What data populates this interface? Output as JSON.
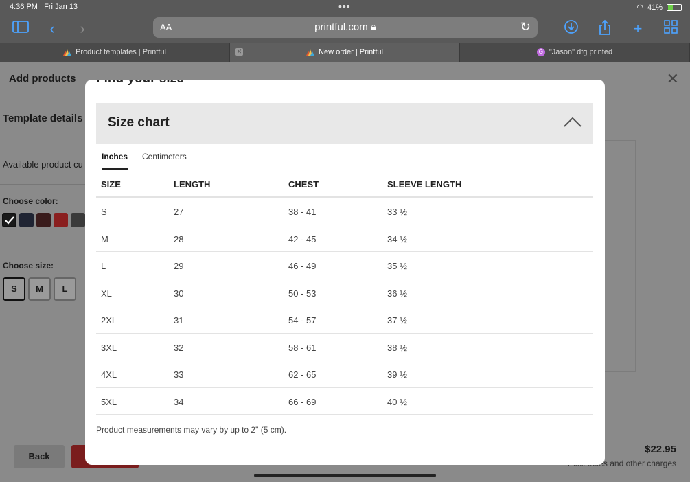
{
  "status": {
    "time": "4:36 PM",
    "date": "Fri Jan 13",
    "battery": "41%",
    "battery_level": 0.41
  },
  "browser": {
    "aa_label": "AA",
    "url": "printful.com",
    "tabs": [
      {
        "label": "Product templates | Printful"
      },
      {
        "label": "New order | Printful"
      },
      {
        "label": "\"Jason\" dtg printed"
      }
    ]
  },
  "page": {
    "title": "Add products",
    "template_details": "Template details",
    "available": "Available product cu",
    "choose_color": "Choose color:",
    "colors": [
      "#1a1a1a",
      "#1f2433",
      "#3a1c1c",
      "#8a1f1f",
      "#3a3a3a"
    ],
    "choose_size": "Choose size:",
    "sizes": [
      "S",
      "M",
      "L"
    ],
    "back": "Back",
    "price": "$22.95",
    "taxes": "Excl. taxes and other charges"
  },
  "modal": {
    "title": "Find your size",
    "section": "Size chart",
    "unit_tabs": [
      "Inches",
      "Centimeters"
    ],
    "active_unit": "Inches",
    "columns": [
      "SIZE",
      "LENGTH",
      "CHEST",
      "SLEEVE LENGTH"
    ],
    "rows": [
      [
        "S",
        "27",
        "38 - 41",
        "33 ½"
      ],
      [
        "M",
        "28",
        "42 - 45",
        "34 ½"
      ],
      [
        "L",
        "29",
        "46 - 49",
        "35 ½"
      ],
      [
        "XL",
        "30",
        "50 - 53",
        "36 ½"
      ],
      [
        "2XL",
        "31",
        "54 - 57",
        "37 ½"
      ],
      [
        "3XL",
        "32",
        "58 - 61",
        "38 ½"
      ],
      [
        "4XL",
        "33",
        "62 - 65",
        "39 ½"
      ],
      [
        "5XL",
        "34",
        "66 - 69",
        "40 ½"
      ]
    ],
    "note": "Product measurements may vary by up to 2\" (5 cm)."
  }
}
